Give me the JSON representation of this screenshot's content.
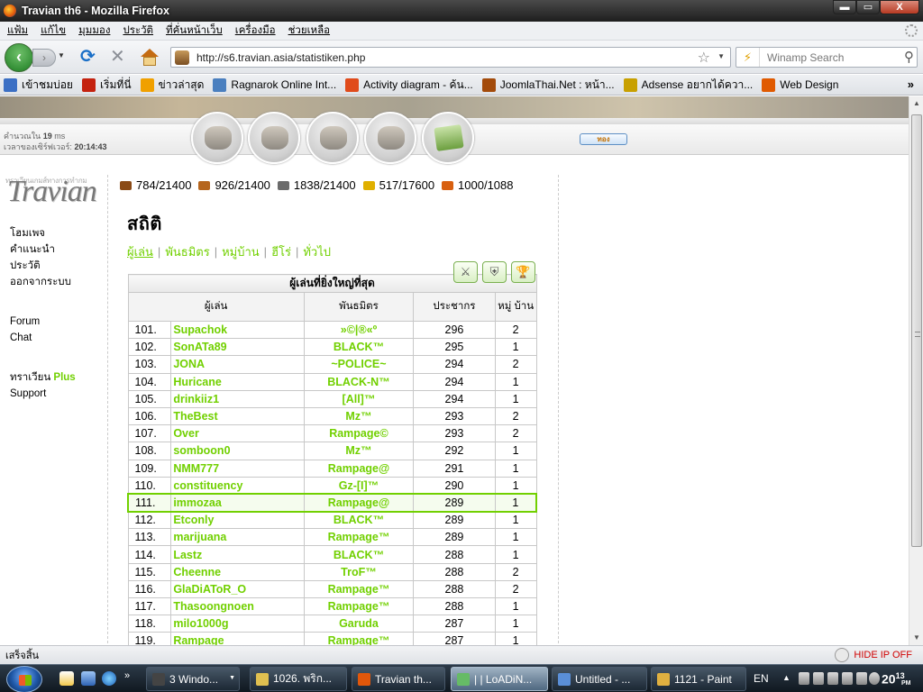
{
  "window": {
    "title": "Travian th6 - Mozilla Firefox",
    "min_label": "▬",
    "max_label": "▭",
    "close_label": "X"
  },
  "menu": [
    "แฟ้ม",
    "แก้ไข",
    "มุมมอง",
    "ประวัติ",
    "ที่คั่นหน้าเว็บ",
    "เครื่องมือ",
    "ช่วยเหลือ"
  ],
  "nav": {
    "url": "http://s6.travian.asia/statistiken.php",
    "search_placeholder": "Winamp Search"
  },
  "bookmarks": [
    {
      "label": "เข้าชมบ่อย",
      "color": "#3b6fc4"
    },
    {
      "label": "เริ่มที่นี่",
      "color": "#c4220f"
    },
    {
      "label": "ข่าวล่าสุด",
      "color": "#f0a000"
    },
    {
      "label": "Ragnarok Online Int...",
      "color": "#4a7fbf"
    },
    {
      "label": "Activity diagram - ค้น...",
      "color": "#e04b1b"
    },
    {
      "label": "JoomlaThai.Net : หน้า...",
      "color": "#a34b0b"
    },
    {
      "label": "Adsense อยากได้ควา...",
      "color": "#c8a000"
    },
    {
      "label": "Web Design",
      "color": "#e05a00"
    }
  ],
  "bookmarks_more": "»",
  "header": {
    "calc_label": "คำนวณใน",
    "calc_value": "19",
    "calc_unit": "ms",
    "server_time_label": "เวลาของเซิร์ฟเวอร์:",
    "server_time": "20:14:43",
    "gold_button": "ทอง"
  },
  "logo": {
    "small_text": "ทราเวียนเกมส์ทางการทำกม",
    "big_text": "Travian"
  },
  "sidebar": {
    "items": [
      "โฮมเพจ",
      "คำแนะนำ",
      "ประวัติ",
      "ออกจากระบบ"
    ],
    "items2": [
      "Forum",
      "Chat"
    ],
    "plus_prefix": "ทราเวียน",
    "plus_label": "Plus",
    "support": "Support"
  },
  "resources": [
    {
      "value": "784/21400",
      "color": "#8a4a15"
    },
    {
      "value": "926/21400",
      "color": "#b5651d"
    },
    {
      "value": "1838/21400",
      "color": "#6b6b6b"
    },
    {
      "value": "517/17600",
      "color": "#e0b000"
    },
    {
      "value": "1000/1088",
      "color": "#d86010"
    }
  ],
  "page": {
    "title": "สถิติ",
    "tabs": [
      "ผู้เล่น",
      "พันธมิตร",
      "หมู่บ้าน",
      "ฮีโร่",
      "ทั่วไป"
    ],
    "table_caption": "ผู้เล่นที่ยิ่งใหญ่ที่สุด",
    "headers": {
      "player": "ผู้เล่น",
      "alliance": "พันธมิตร",
      "population": "ประชากร",
      "villages": "หมู่ บ้าน"
    }
  },
  "rows": [
    {
      "rank": "101.",
      "player": "Supachok",
      "alliance": "»©|®«º",
      "pop": "296",
      "vil": "2"
    },
    {
      "rank": "102.",
      "player": "SonATa89",
      "alliance": "BLACK™",
      "pop": "295",
      "vil": "1"
    },
    {
      "rank": "103.",
      "player": "JONA",
      "alliance": "~POLICE~",
      "pop": "294",
      "vil": "2"
    },
    {
      "rank": "104.",
      "player": "Huricane",
      "alliance": "BLACK-N™",
      "pop": "294",
      "vil": "1"
    },
    {
      "rank": "105.",
      "player": "drinkiiz1",
      "alliance": "[All]™",
      "pop": "294",
      "vil": "1"
    },
    {
      "rank": "106.",
      "player": "TheBest",
      "alliance": "Mz™",
      "pop": "293",
      "vil": "2"
    },
    {
      "rank": "107.",
      "player": "Over",
      "alliance": "Rampage©",
      "pop": "293",
      "vil": "2"
    },
    {
      "rank": "108.",
      "player": "somboon0",
      "alliance": "Mz™",
      "pop": "292",
      "vil": "1"
    },
    {
      "rank": "109.",
      "player": "NMM777",
      "alliance": "Rampage@",
      "pop": "291",
      "vil": "1"
    },
    {
      "rank": "110.",
      "player": "constituency",
      "alliance": "Gz-[I]™",
      "pop": "290",
      "vil": "1"
    },
    {
      "rank": "111.",
      "player": "immozaa",
      "alliance": "Rampage@",
      "pop": "289",
      "vil": "1",
      "highlight": true
    },
    {
      "rank": "112.",
      "player": "Etconly",
      "alliance": "BLACK™",
      "pop": "289",
      "vil": "1"
    },
    {
      "rank": "113.",
      "player": "marijuana",
      "alliance": "Rampage™",
      "pop": "289",
      "vil": "1"
    },
    {
      "rank": "114.",
      "player": "Lastz",
      "alliance": "BLACK™",
      "pop": "288",
      "vil": "1"
    },
    {
      "rank": "115.",
      "player": "Cheenne",
      "alliance": "TroF™",
      "pop": "288",
      "vil": "2"
    },
    {
      "rank": "116.",
      "player": "GlaDiAToR_O",
      "alliance": "Rampage™",
      "pop": "288",
      "vil": "2"
    },
    {
      "rank": "117.",
      "player": "Thasoongnoen",
      "alliance": "Rampage™",
      "pop": "288",
      "vil": "1"
    },
    {
      "rank": "118.",
      "player": "milo1000g",
      "alliance": "Garuda",
      "pop": "287",
      "vil": "1"
    },
    {
      "rank": "119.",
      "player": "Rampage",
      "alliance": "Rampage™",
      "pop": "287",
      "vil": "1"
    }
  ],
  "status": {
    "text": "เสร็จสิ้น",
    "hide_ip": "HIDE IP OFF"
  },
  "taskbar": {
    "tasks": [
      {
        "label": "3 Windo...",
        "icon_color": "#444"
      },
      {
        "label": "1026. พริก...",
        "icon_color": "#e0c050"
      },
      {
        "label": "Travian th...",
        "icon_color": "#e2570a"
      },
      {
        "label": "| | LoADiN...",
        "icon_color": "#66bb66"
      },
      {
        "label": "Untitled - ...",
        "icon_color": "#5a8fd8"
      },
      {
        "label": "1121 - Paint",
        "icon_color": "#e0b040"
      }
    ],
    "lang": "EN",
    "time": "20",
    "time2": "13",
    "ampm": "PM"
  }
}
